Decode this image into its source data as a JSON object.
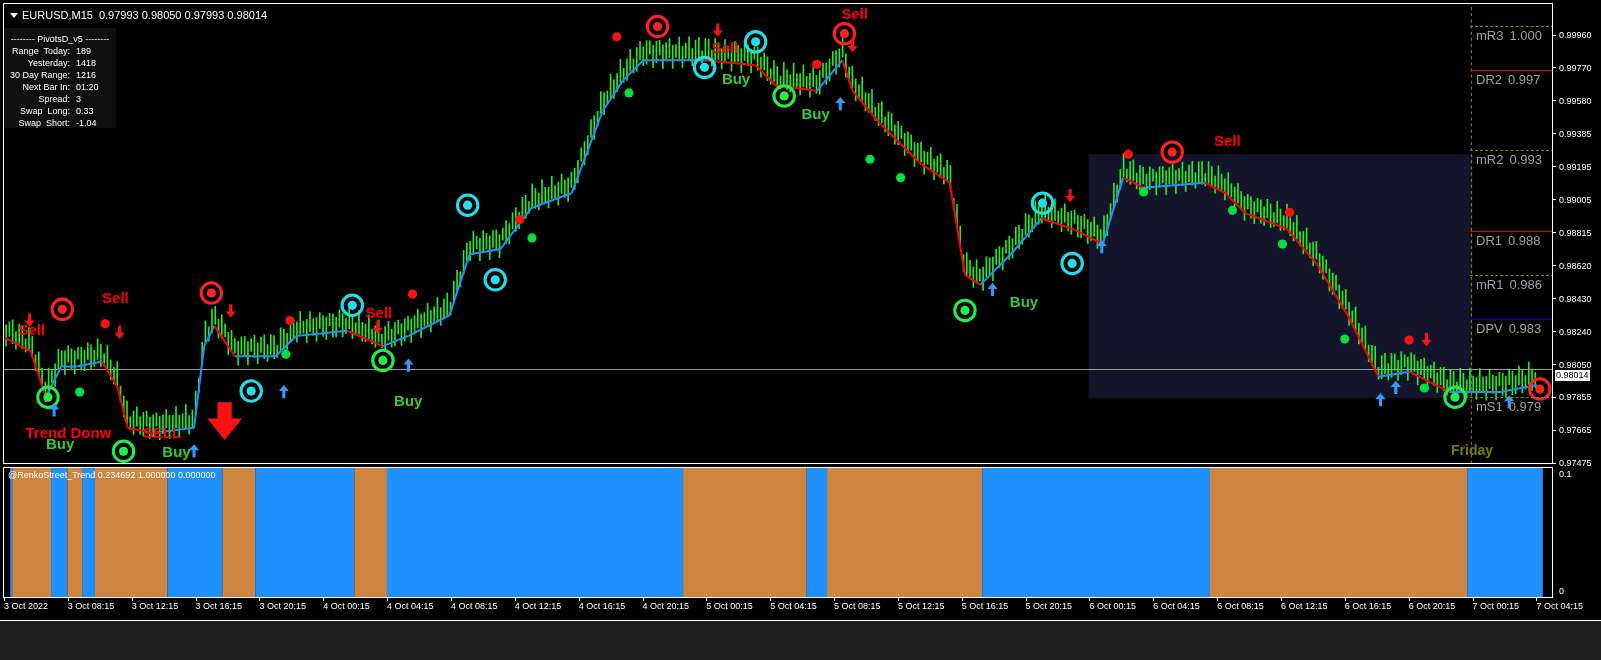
{
  "chart": {
    "symbol": "EURUSD,M15",
    "ohlc": "0.97993 0.98050 0.97993 0.98014"
  },
  "info_panel": {
    "title": "-------- PivotsD_v5 --------",
    "rows": [
      {
        "label": "Range  Today:",
        "value": "189"
      },
      {
        "label": "Yesterday:",
        "value": "1418"
      },
      {
        "label": "30 Day Range:",
        "value": "1216"
      },
      {
        "label": "Next Bar In:",
        "value": "01:20"
      },
      {
        "label": "Spread:",
        "value": "3"
      },
      {
        "label": "Swap  Long:",
        "value": "0.33"
      },
      {
        "label": "Swap  Short:",
        "value": "-1.04"
      }
    ]
  },
  "signal_labels": [
    {
      "text": "Sell",
      "kind": "sell"
    },
    {
      "text": "Sell",
      "kind": "sell"
    },
    {
      "text": "Trend Donw",
      "kind": "sell"
    },
    {
      "text": "SELL",
      "kind": "sell"
    },
    {
      "text": "Buy",
      "kind": "buy"
    },
    {
      "text": "Buy",
      "kind": "buy"
    },
    {
      "text": "Sell",
      "kind": "sell"
    },
    {
      "text": "Buy",
      "kind": "buy"
    },
    {
      "text": "Sell",
      "kind": "sell"
    },
    {
      "text": "Buy",
      "kind": "buy"
    },
    {
      "text": "Buy",
      "kind": "buy"
    },
    {
      "text": "Sell",
      "kind": "sell"
    },
    {
      "text": "Buy",
      "kind": "buy"
    },
    {
      "text": "Sell",
      "kind": "sell"
    }
  ],
  "pivots": [
    {
      "label": "mR3",
      "value": "1.000",
      "kind": "mid"
    },
    {
      "label": "DR2",
      "value": "0.997",
      "kind": "resistance"
    },
    {
      "label": "mR2",
      "value": "0.993",
      "kind": "mid"
    },
    {
      "label": "DR1",
      "value": "0.988",
      "kind": "resistance"
    },
    {
      "label": "mR1",
      "value": "0.986",
      "kind": "mid"
    },
    {
      "label": "DPV",
      "value": "0.983",
      "kind": "pivot"
    },
    {
      "label": "mS1",
      "value": "0.979",
      "kind": "mid"
    }
  ],
  "day_label": "Friday",
  "price_axis": [
    "0.99960",
    "0.99770",
    "0.99580",
    "0.99385",
    "0.99195",
    "0.99005",
    "0.98815",
    "0.98620",
    "0.98430",
    "0.98240",
    "0.98050",
    "0.97855",
    "0.97665",
    "0.97475"
  ],
  "current_price": "0.98014",
  "indicator": {
    "label": "@RenkoStreet_Trend 0.234692 1.000000 0.000000",
    "axis": [
      "0.1",
      "0"
    ]
  },
  "time_axis": [
    "3 Oct 2022",
    "3 Oct 08:15",
    "3 Oct 12:15",
    "3 Oct 16:15",
    "3 Oct 20:15",
    "4 Oct 00:15",
    "4 Oct 04:15",
    "4 Oct 08:15",
    "4 Oct 12:15",
    "4 Oct 16:15",
    "4 Oct 20:15",
    "5 Oct 00:15",
    "5 Oct 04:15",
    "5 Oct 08:15",
    "5 Oct 12:15",
    "5 Oct 16:15",
    "5 Oct 20:15",
    "6 Oct 00:15",
    "6 Oct 04:15",
    "6 Oct 08:15",
    "6 Oct 12:15",
    "6 Oct 16:15",
    "6 Oct 20:15",
    "7 Oct 00:15",
    "7 Oct 04:15"
  ]
}
